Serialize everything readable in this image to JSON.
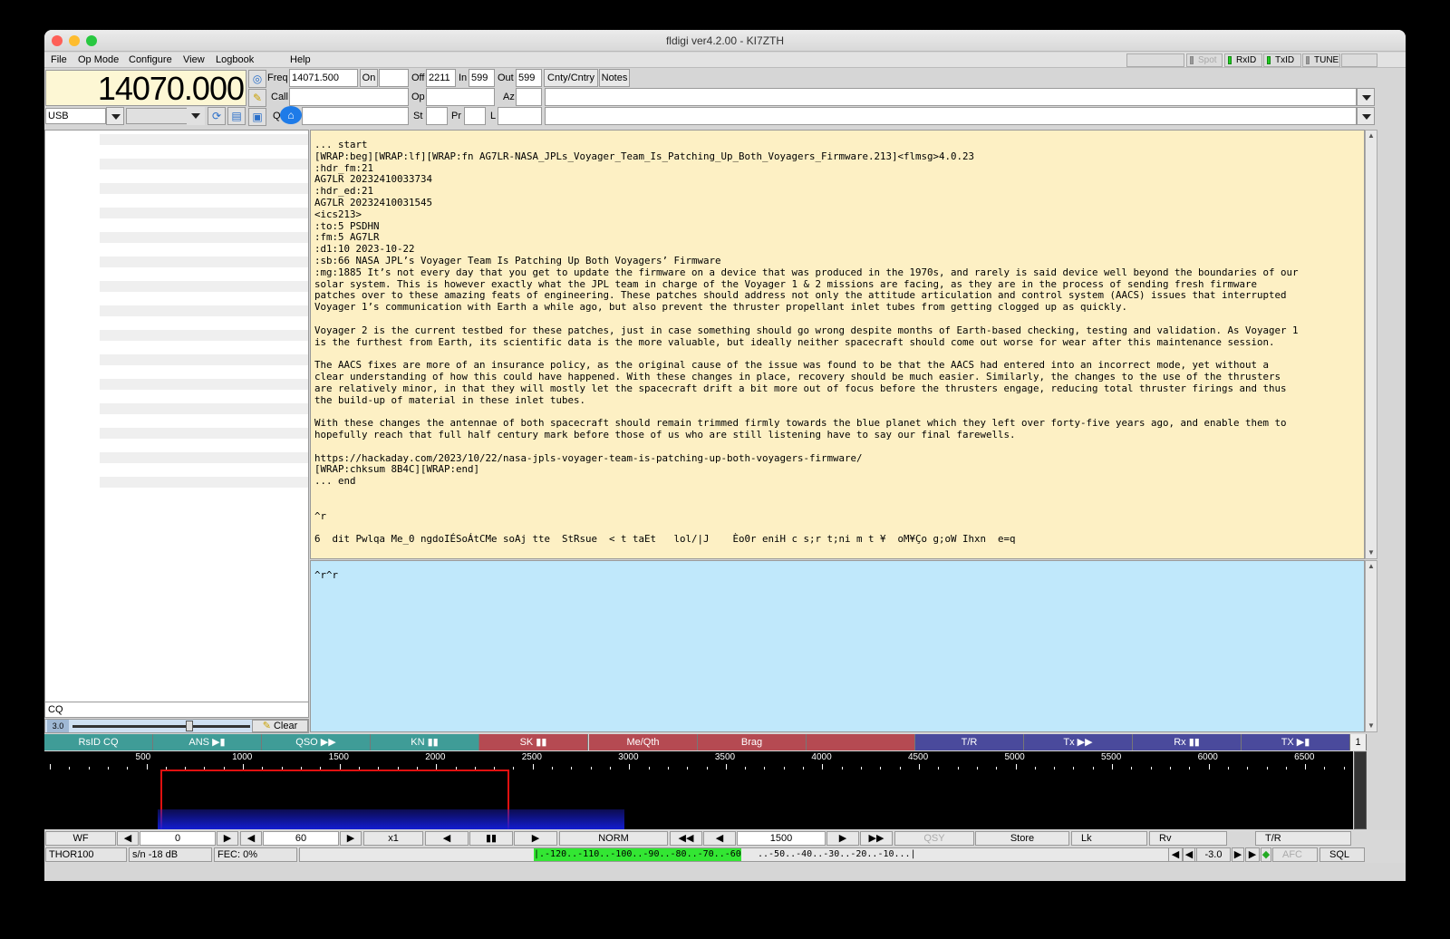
{
  "window": {
    "title": "fldigi ver4.2.00 - KI7ZTH"
  },
  "menu": [
    "File",
    "Op Mode",
    "Configure",
    "View",
    "Logbook",
    "Help"
  ],
  "menu_right": {
    "spot": "Spot",
    "rxid": "RxID",
    "txid": "TxID",
    "tune": "TUNE"
  },
  "rig": {
    "frequency": "14070.000",
    "mode": "USB"
  },
  "log": {
    "freq_label": "Freq",
    "freq": "14071.500",
    "on_label": "On",
    "on": "",
    "off_label": "Off",
    "off": "2211",
    "in_label": "In",
    "in": "599",
    "out_label": "Out",
    "out": "599",
    "cnty_button": "Cnty/Cntry",
    "notes_button": "Notes",
    "call_label": "Call",
    "call": "",
    "op_label": "Op",
    "op": "",
    "az_label": "Az",
    "az": "",
    "qth_label": "Q",
    "qth": "",
    "st_label": "St",
    "st": "",
    "pr_label": "Pr",
    "pr": "",
    "l_label": "L",
    "l": ""
  },
  "rx_text": "... start\n[WRAP:beg][WRAP:lf][WRAP:fn AG7LR-NASA_JPLs_Voyager_Team_Is_Patching_Up_Both_Voyagers_Firmware.213]<flmsg>4.0.23\n:hdr_fm:21\nAG7LR 20232410033734\n:hdr_ed:21\nAG7LR 20232410031545\n<ics213>\n:to:5 PSDHN\n:fm:5 AG7LR\n:d1:10 2023-10-22\n:sb:66 NASA JPL’s Voyager Team Is Patching Up Both Voyagers’ Firmware\n:mg:1885 It’s not every day that you get to update the firmware on a device that was produced in the 1970s, and rarely is said device well beyond the boundaries of our\nsolar system. This is however exactly what the JPL team in charge of the Voyager 1 & 2 missions are facing, as they are in the process of sending fresh firmware\npatches over to these amazing feats of engineering. These patches should address not only the attitude articulation and control system (AACS) issues that interrupted\nVoyager 1’s communication with Earth a while ago, but also prevent the thruster propellant inlet tubes from getting clogged up as quickly.\n\nVoyager 2 is the current testbed for these patches, just in case something should go wrong despite months of Earth-based checking, testing and validation. As Voyager 1\nis the furthest from Earth, its scientific data is the more valuable, but ideally neither spacecraft should come out worse for wear after this maintenance session.\n\nThe AACS fixes are more of an insurance policy, as the original cause of the issue was found to be that the AACS had entered into an incorrect mode, yet without a\nclear understanding of how this could have happened. With these changes in place, recovery should be much easier. Similarly, the changes to the use of the thrusters\nare relatively minor, in that they will mostly let the spacecraft drift a bit more out of focus before the thrusters engage, reducing total thruster firings and thus\nthe build-up of material in these inlet tubes.\n\nWith these changes the antennae of both spacecraft should remain trimmed firmly towards the blue planet which they left over forty-five years ago, and enable them to\nhopefully reach that full half century mark before those of us who are still listening have to say our final farewells.\n\nhttps://hackaday.com/2023/10/22/nasa-jpls-voyager-team-is-patching-up-both-voyagers-firmware/\n[WRAP:chksum 8B4C][WRAP:end]\n... end\n\n\n^r\n\n6  dit Pwlqa Me_0 ngdoIÉSoÁtCMe soAj tte  StRsue  < t taEt   lol/|J    Èo0r eniH c s;r t;ni m t ¥  oM¥Ço g;oW Ihxn  e=q",
  "tx_text": "^r^r",
  "cq_text": "CQ",
  "sql": {
    "value": "3.0",
    "clear_button": "Clear"
  },
  "macros": [
    {
      "label": "RsID CQ",
      "color": "#3f9c97"
    },
    {
      "label": "ANS ▶▮",
      "color": "#3f9c97"
    },
    {
      "label": "QSO ▶▶",
      "color": "#3f9c97"
    },
    {
      "label": "KN ▮▮",
      "color": "#3f9c97"
    },
    {
      "label": "SK ▮▮",
      "color": "#b54a52"
    },
    {
      "label": "Me/Qth",
      "color": "#b54a52"
    },
    {
      "label": "Brag",
      "color": "#b54a52"
    },
    {
      "label": "",
      "color": "#b54a52"
    },
    {
      "label": "T/R",
      "color": "#4a4a9c"
    },
    {
      "label": "Tx ▶▶",
      "color": "#4a4a9c"
    },
    {
      "label": "Rx ▮▮",
      "color": "#4a4a9c"
    },
    {
      "label": "TX ▶▮",
      "color": "#4a4a9c"
    }
  ],
  "macro_set": "1",
  "scale_ticks": [
    "500",
    "1000",
    "1500",
    "2000",
    "2500",
    "3000",
    "3500",
    "4000",
    "4500",
    "5000",
    "5500",
    "6000",
    "6500"
  ],
  "waterfall_controls": {
    "wf": "WF",
    "offset": "0",
    "rate": "60",
    "zoom": "x1",
    "norm": "NORM",
    "carrier": "1500",
    "qsy": "QSY",
    "store": "Store",
    "lk": "Lk",
    "rv": "Rv",
    "tr": "T/R"
  },
  "status": {
    "mode": "THOR100",
    "sn": "s/n -18 dB",
    "fec": "FEC:  0%",
    "meter_green": "|.-120..-110..-100..-90..-80..-70..-60",
    "meter_rest": "..-50..-40..-30..-20..-10...|",
    "squelch_level": "-3.0",
    "afc": "AFC",
    "sql": "SQL"
  },
  "colors": {
    "rx_bg": "#fdf0c4",
    "tx_bg": "#c0e8fb",
    "meter_green": "#33e633",
    "carrier_marker": "#e01010"
  }
}
